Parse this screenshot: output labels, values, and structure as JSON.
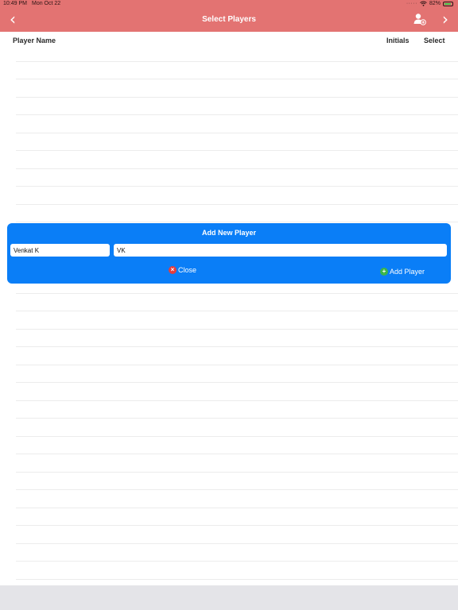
{
  "status_bar": {
    "time": "10:49 PM",
    "date": "Mon Oct 22",
    "battery": "82%"
  },
  "nav": {
    "title": "Select Players",
    "back_icon": "chevron-left-icon",
    "forward_icon": "chevron-right-icon",
    "add_user_icon": "add-user-icon"
  },
  "table_header": {
    "player_name": "Player Name",
    "initials": "Initials",
    "select": "Select"
  },
  "add_player_card": {
    "title": "Add New Player",
    "name_value": "Venkat K",
    "initials_value": "VK",
    "close_label": "Close",
    "add_label": "Add Player"
  },
  "colors": {
    "nav_bar": "#e37372",
    "card": "#0a7ef7",
    "close_icon": "#e53d3d",
    "add_icon": "#3bb54a"
  }
}
